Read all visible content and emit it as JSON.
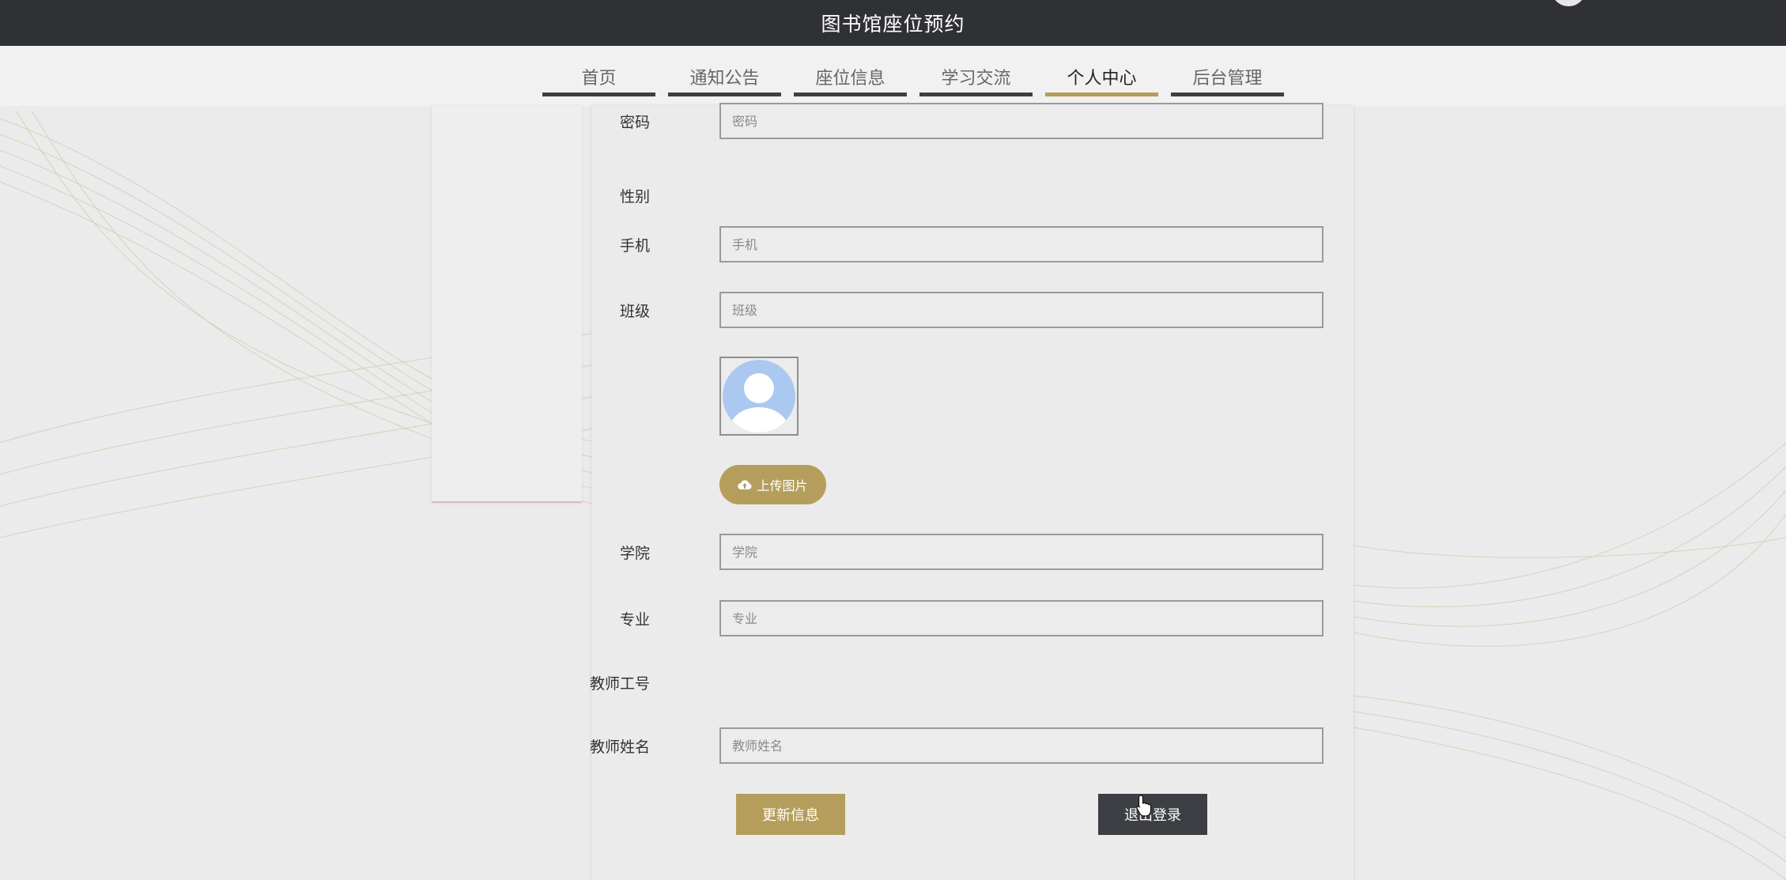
{
  "header": {
    "title": "图书馆座位预约"
  },
  "nav": {
    "items": [
      {
        "label": "首页"
      },
      {
        "label": "通知公告"
      },
      {
        "label": "座位信息"
      },
      {
        "label": "学习交流"
      },
      {
        "label": "个人中心",
        "active": true
      },
      {
        "label": "后台管理"
      }
    ]
  },
  "form": {
    "password": {
      "label": "密码",
      "placeholder": "密码",
      "value": ""
    },
    "gender": {
      "label": "性别"
    },
    "phone": {
      "label": "手机",
      "placeholder": "手机",
      "value": ""
    },
    "class": {
      "label": "班级",
      "placeholder": "班级",
      "value": ""
    },
    "avatar": {
      "icon": "user-silhouette-icon"
    },
    "upload": {
      "label": "上传图片",
      "icon": "cloud-upload-icon"
    },
    "college": {
      "label": "学院",
      "placeholder": "学院",
      "value": ""
    },
    "major": {
      "label": "专业",
      "placeholder": "专业",
      "value": ""
    },
    "teacher_id": {
      "label": "教师工号"
    },
    "teacher_name": {
      "label": "教师姓名",
      "placeholder": "教师姓名",
      "value": ""
    }
  },
  "actions": {
    "update_label": "更新信息",
    "logout_label": "退出登录"
  },
  "colors": {
    "header_bg": "#2f3134",
    "accent": "#b59e5b",
    "dark_button": "#3d3f44",
    "avatar_blue": "#aac8f0"
  }
}
